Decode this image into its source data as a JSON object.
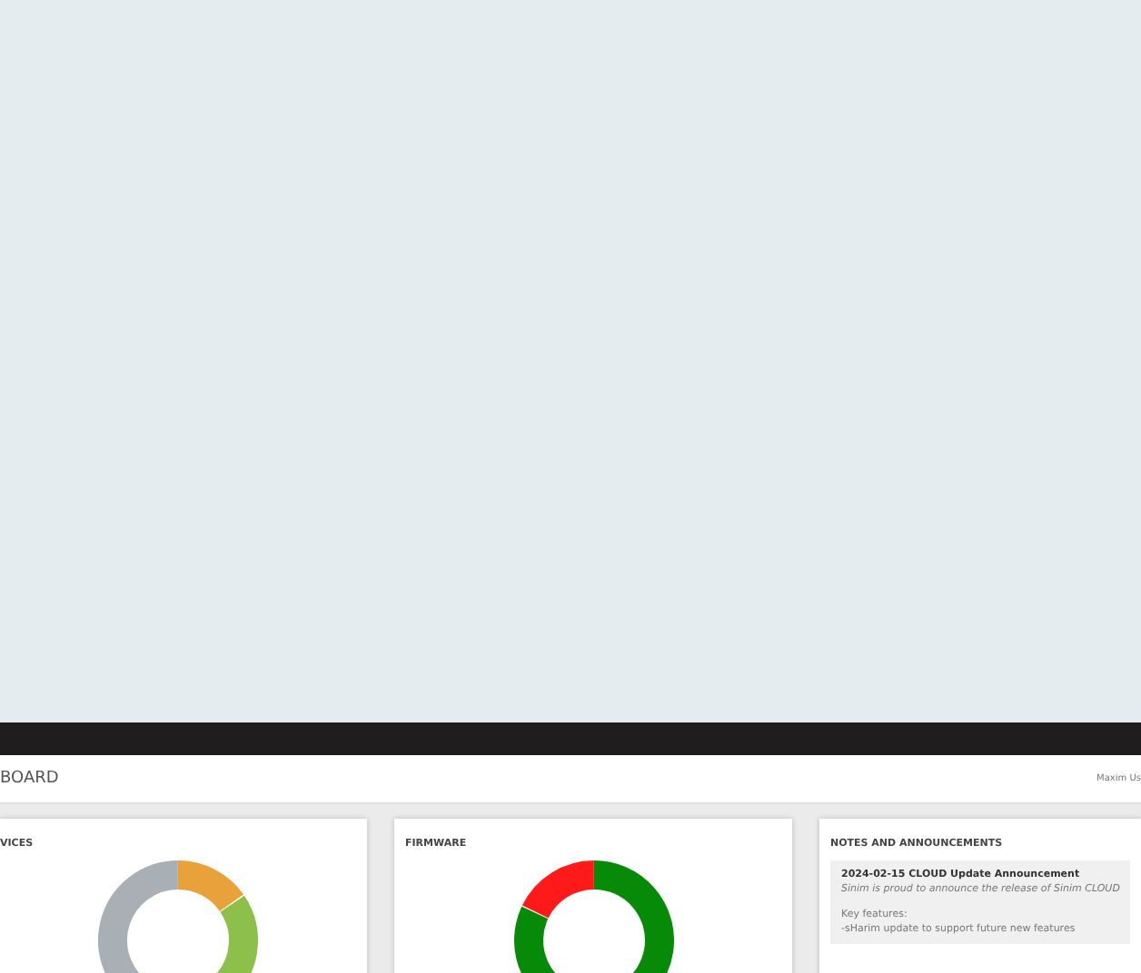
{
  "header": {
    "title": "BOARD",
    "user": "Maxim Us"
  },
  "cards": [
    {
      "kind": "devices",
      "title": "VICES"
    },
    {
      "kind": "firmware",
      "title": "FIRMWARE"
    },
    {
      "kind": "notes",
      "title": "NOTES AND ANNOUNCEMENTS",
      "note": {
        "title": "2024-02-15 CLOUD Update Announcement",
        "intro": "Sinim is proud to announce the release of Sinim CLOUD",
        "features_label": "Key features:",
        "feature": "-sHarim update to support future new features"
      }
    }
  ]
}
